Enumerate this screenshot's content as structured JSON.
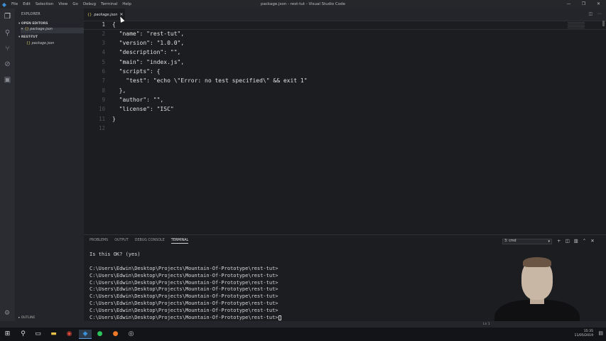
{
  "titlebar": {
    "menu": [
      "File",
      "Edit",
      "Selection",
      "View",
      "Go",
      "Debug",
      "Terminal",
      "Help"
    ],
    "window_title": "package.json - rest-tut - Visual Studio Code",
    "controls": [
      "—",
      "❐",
      "✕"
    ]
  },
  "sidebar": {
    "title": "EXPLORER",
    "open_editors_label": "OPEN EDITORS",
    "open_editors": [
      {
        "close": "✕",
        "name": "package.json"
      }
    ],
    "folder_label": "REST-TUT",
    "files": [
      {
        "name": "package.json"
      }
    ],
    "outline_label": "OUTLINE"
  },
  "tab": {
    "label": "package.json",
    "close": "✕"
  },
  "editor": {
    "line_numbers": [
      "1",
      "2",
      "3",
      "4",
      "5",
      "6",
      "7",
      "8",
      "9",
      "10",
      "11",
      "12"
    ],
    "lines": [
      "{",
      "  \"name\": \"rest-tut\",",
      "  \"version\": \"1.0.0\",",
      "  \"description\": \"\",",
      "  \"main\": \"index.js\",",
      "  \"scripts\": {",
      "    \"test\": \"echo \\\"Error: no test specified\\\" && exit 1\"",
      "  },",
      "  \"author\": \"\",",
      "  \"license\": \"ISC\"",
      "}",
      ""
    ]
  },
  "panel": {
    "tabs": [
      "PROBLEMS",
      "OUTPUT",
      "DEBUG CONSOLE",
      "TERMINAL"
    ],
    "active_tab": "TERMINAL",
    "terminal_select": "3: cmd",
    "terminal_lines": [
      "Is this OK? (yes)",
      "",
      "C:\\Users\\Edwin\\Desktop\\Projects\\Mountain-Of-Prototype\\rest-tut>",
      "C:\\Users\\Edwin\\Desktop\\Projects\\Mountain-Of-Prototype\\rest-tut>",
      "C:\\Users\\Edwin\\Desktop\\Projects\\Mountain-Of-Prototype\\rest-tut>",
      "C:\\Users\\Edwin\\Desktop\\Projects\\Mountain-Of-Prototype\\rest-tut>",
      "C:\\Users\\Edwin\\Desktop\\Projects\\Mountain-Of-Prototype\\rest-tut>",
      "C:\\Users\\Edwin\\Desktop\\Projects\\Mountain-Of-Prototype\\rest-tut>",
      "C:\\Users\\Edwin\\Desktop\\Projects\\Mountain-Of-Prototype\\rest-tut>",
      "C:\\Users\\Edwin\\Desktop\\Projects\\Mountain-Of-Prototype\\rest-tut>"
    ]
  },
  "statusbar": {
    "position": "Ln 1"
  },
  "taskbar": {
    "time": "15:35",
    "date": "11/05/2019"
  },
  "colors": {
    "accent": "#3d8fd6",
    "json_icon": "#d4c25a",
    "editor_bg": "#1b1d20"
  }
}
